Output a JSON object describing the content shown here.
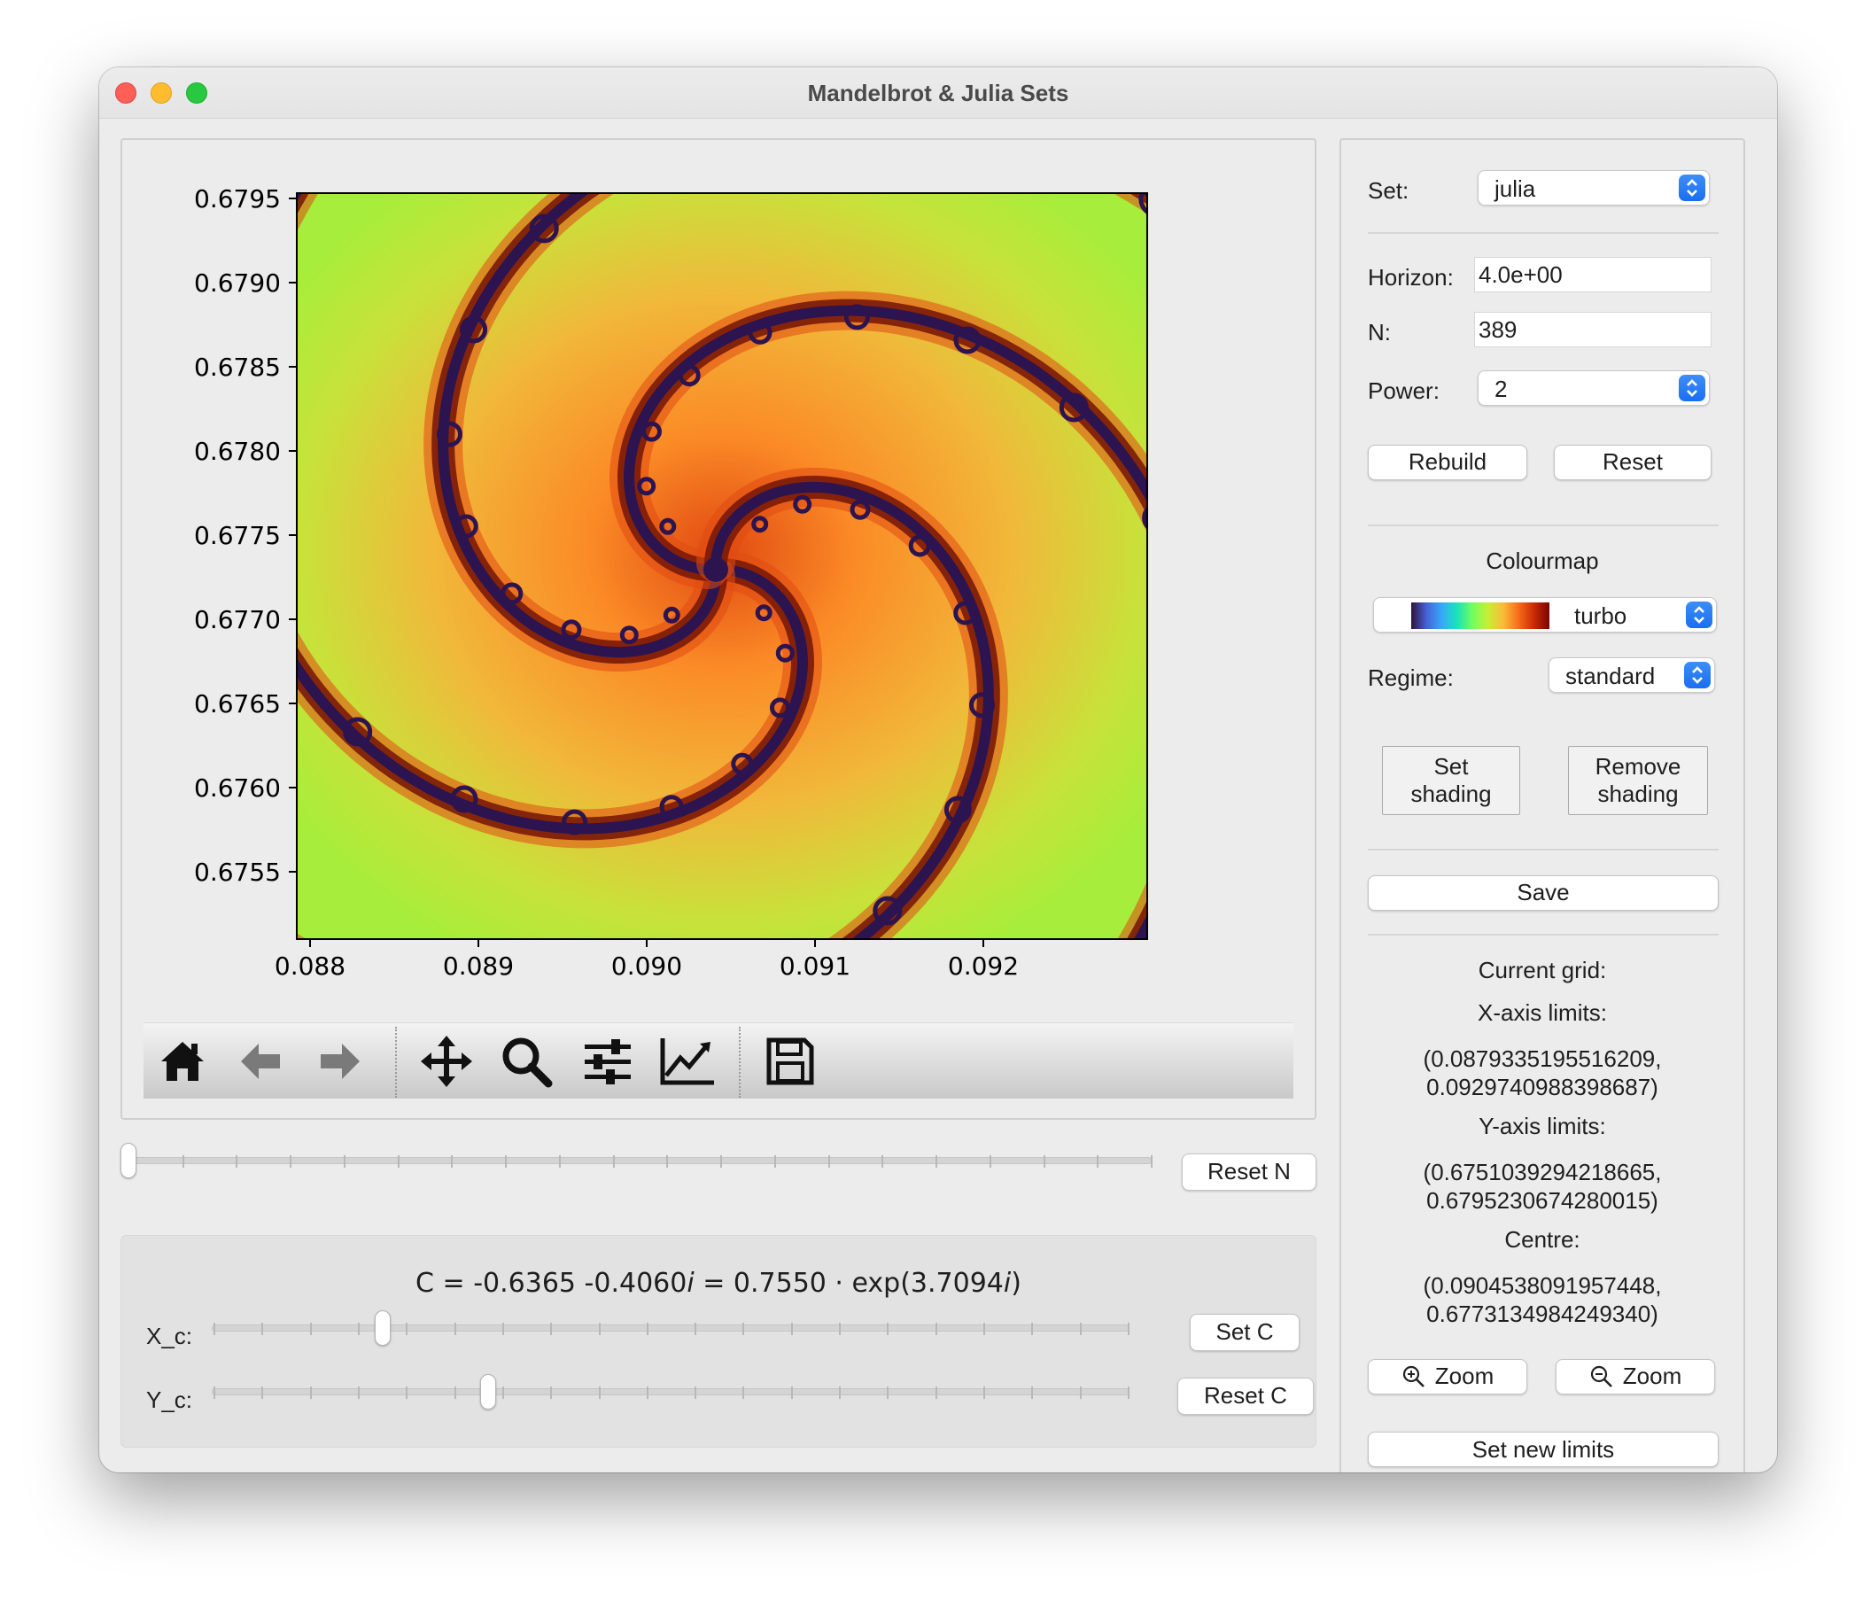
{
  "window": {
    "title": "Mandelbrot & Julia Sets"
  },
  "plot": {
    "y_ticks": [
      "0.6795",
      "0.6790",
      "0.6785",
      "0.6780",
      "0.6775",
      "0.6770",
      "0.6765",
      "0.6760",
      "0.6755"
    ],
    "x_ticks": [
      "0.088",
      "0.089",
      "0.090",
      "0.091",
      "0.092"
    ],
    "colormap_stops": [
      "#a6ee3b",
      "#c8e23a",
      "#f1b83a",
      "#fb8a26",
      "#e04a12",
      "#7a1a08",
      "#2c1450"
    ]
  },
  "toolbar": {
    "icons": [
      "home-icon",
      "back-arrow-icon",
      "forward-arrow-icon",
      "pan-icon",
      "zoom-icon",
      "configure-icon",
      "edit-curves-icon",
      "save-icon"
    ]
  },
  "n_slider": {
    "value_fraction": 0.0,
    "reset_label": "Reset N"
  },
  "c_controls": {
    "formula_parts": [
      "C = -0.6365 -0.4060",
      "i",
      " = 0.7550 · exp(3.7094",
      "i",
      ")"
    ],
    "xc_label": "X_c:",
    "yc_label": "Y_c:",
    "xc_fraction": 0.185,
    "yc_fraction": 0.3,
    "set_label": "Set C",
    "reset_label": "Reset C"
  },
  "panel": {
    "set_label": "Set:",
    "set_value": "julia",
    "horizon_label": "Horizon:",
    "horizon_value": "4.0e+00",
    "n_label": "N:",
    "n_value": "389",
    "power_label": "Power:",
    "power_value": "2",
    "rebuild_label": "Rebuild",
    "reset_label": "Reset",
    "colourmap_title": "Colourmap",
    "colourmap_value": "turbo",
    "regime_label": "Regime:",
    "regime_value": "standard",
    "set_shading_label": "Set\nshading",
    "remove_shading_label": "Remove\nshading",
    "save_label": "Save",
    "current_grid_label": "Current grid:",
    "xlim_label": "X-axis limits:",
    "xlim_line1": "(0.0879335195516209,",
    "xlim_line2": "0.0929740988398687)",
    "ylim_label": "Y-axis limits:",
    "ylim_line1": "(0.6751039294218665,",
    "ylim_line2": "0.6795230674280015)",
    "centre_label": "Centre:",
    "centre_line1": "(0.0904538091957448,",
    "centre_line2": "0.6773134984249340)",
    "zoom_in_label": "Zoom",
    "zoom_out_label": "Zoom",
    "set_new_limits_label": "Set new limits"
  },
  "colors": {
    "accent_blue": "#1a6ef0",
    "window_bg": "#ececec"
  }
}
